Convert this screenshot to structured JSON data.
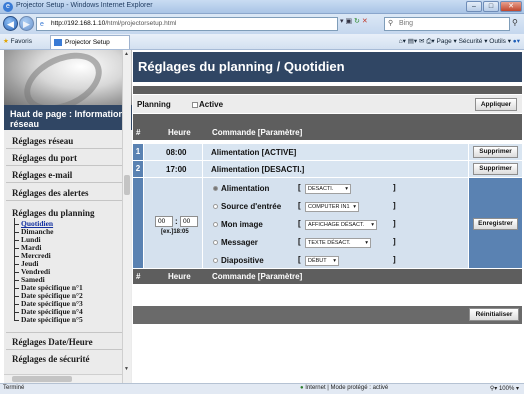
{
  "browser": {
    "window_title": "Projector Setup - Windows Internet Explorer",
    "url_host": "http://192.168.1.10",
    "url_path": "/html/projectorsetup.html",
    "search_placeholder": "Bing",
    "favorites_label": "Favoris",
    "tab_label": "Projector Setup",
    "command_bar": "Page ▾  Sécurité ▾  Outils ▾",
    "status_left": "Terminé",
    "status_zone": "Internet | Mode protégé : activé",
    "zoom": "100%"
  },
  "sidebar": {
    "home": "Haut de page : Informations réseau",
    "items": [
      "Réglages réseau",
      "Réglages du port",
      "Réglages e-mail",
      "Réglages des alertes",
      "Réglages du planning"
    ],
    "sub_items": [
      "Quotidien",
      "Dimanche",
      "Lundi",
      "Mardi",
      "Mercredi",
      "Jeudi",
      "Vendredi",
      "Samedi",
      "Date spécifique n°1",
      "Date spécifique n°2",
      "Date spécifique n°3",
      "Date spécifique n°4",
      "Date spécifique n°5"
    ],
    "after": [
      "Réglages Date/Heure",
      "Réglages de sécurité"
    ]
  },
  "main": {
    "title": "Réglages du planning / Quotidien",
    "planning_label": "Planning",
    "active_label": "Active",
    "apply_button": "Appliquer",
    "table": {
      "col_num": "#",
      "col_time": "Heure",
      "col_command": "Commande [Paramètre]",
      "rows": [
        {
          "num": "1",
          "time": "08:00",
          "command": "Alimentation [ACTIVE]",
          "action": "Supprimer"
        },
        {
          "num": "2",
          "time": "17:00",
          "command": "Alimentation [DESACTI.]",
          "action": "Supprimer"
        }
      ]
    },
    "editor": {
      "hour": "00",
      "minute": "00",
      "example": "[ex.]18:05",
      "register_button": "Enregistrer",
      "options": [
        {
          "label": "Alimentation",
          "value": "DESACTI."
        },
        {
          "label": "Source d'entrée",
          "value": "COMPUTER IN1"
        },
        {
          "label": "Mon image",
          "value": "AFFICHAGE DÉSACT."
        },
        {
          "label": "Messager",
          "value": "TEXTE DÉSACT."
        },
        {
          "label": "Diapositive",
          "value": "DÉBUT"
        }
      ]
    },
    "reset_button": "Réinitialiser"
  }
}
